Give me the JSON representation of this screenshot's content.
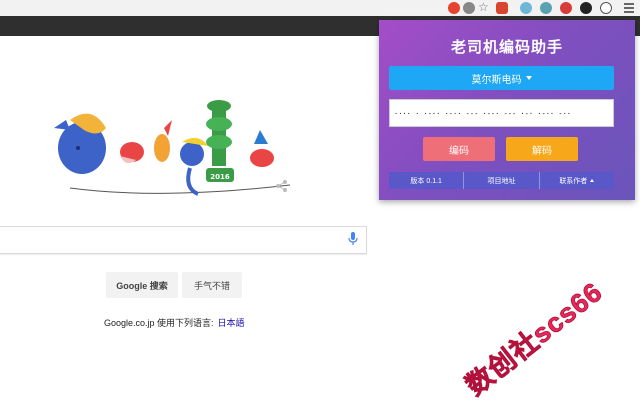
{
  "extension_popup": {
    "title": "老司机编码助手",
    "codec_selected": "莫尔斯电码",
    "output_text": "···· · ·-·· ·-·· --- ·--· --- ·-· ·-·· -··",
    "encode_label": "编码",
    "decode_label": "解码",
    "footer": {
      "version_label": "版本 0.1.1",
      "project_label": "项目地址",
      "contact_label": "联系作者"
    },
    "colors": {
      "gradient_start": "#a44dc8",
      "gradient_end": "#6a55bb",
      "select_bg": "#1ea7f5",
      "encode_bg": "#ee6f78",
      "decode_bg": "#f7a71a",
      "footer_bg": "#5a58c9"
    }
  },
  "google": {
    "search_button": "Google 搜索",
    "lucky_button": "手气不错",
    "language_prefix": "Google.co.jp 使用下列语言:",
    "language_link": "日本語"
  },
  "watermark": "数创社scs66",
  "toolbar": {
    "icons": [
      "extension-red-icon",
      "extension-gray-icon",
      "star-icon",
      "shield-extension-icon",
      "extension-blue-icon",
      "extension-santa-icon",
      "extension-dark-icon",
      "morse-extension-icon",
      "menu-icon",
      "settings-gear-icon"
    ]
  }
}
